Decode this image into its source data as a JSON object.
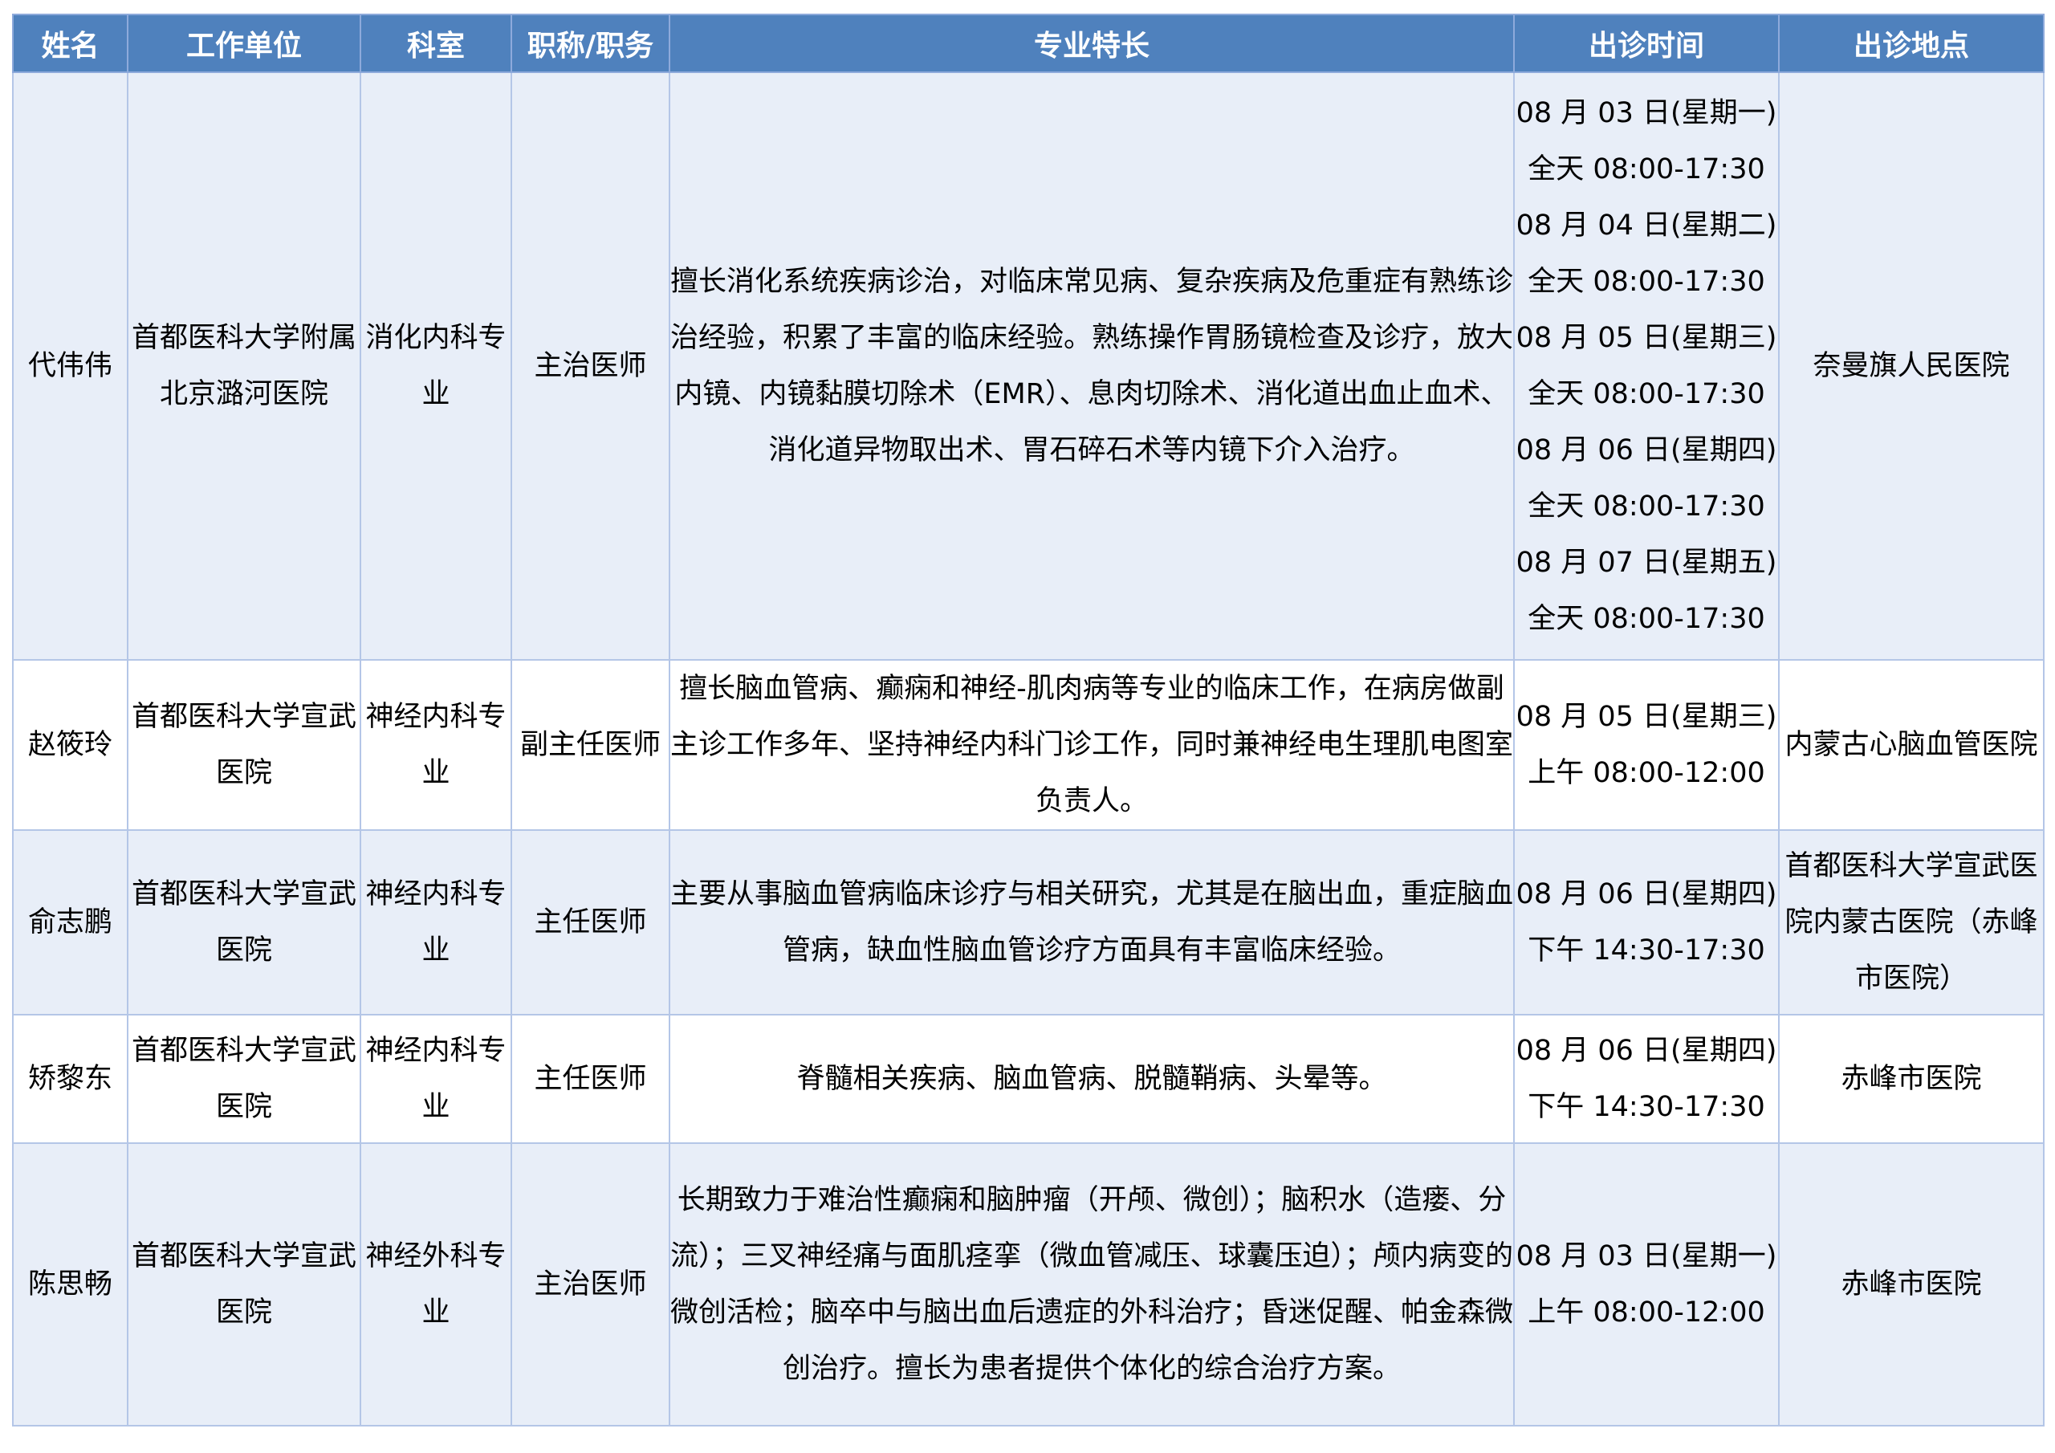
{
  "headers": [
    "姓名",
    "工作单位",
    "科室",
    "职称/职务",
    "专业特长",
    "出诊时间",
    "出诊地点"
  ],
  "rows": [
    {
      "name": "代伟伟",
      "unit": "首都医科大学附属北京潞河医院",
      "dept": "消化内科专业",
      "title": "主治医师",
      "specialty": "擅长消化系统疾病诊治，对临床常见病、复杂疾病及危重症有熟练诊治经验，积累了丰富的临床经验。熟练操作胃肠镜检查及诊疗，放大内镜、内镜黏膜切除术（EMR）、息肉切除术、消化道出血止血术、消化道异物取出术、胃石碎石术等内镜下介入治疗。",
      "times": [
        "08 月 03 日(星期一)",
        "全天 08:00-17:30",
        "08 月 04 日(星期二)",
        "全天 08:00-17:30",
        "08 月 05 日(星期三)",
        "全天 08:00-17:30",
        "08 月 06 日(星期四)",
        "全天 08:00-17:30",
        "08 月 07 日(星期五)",
        "全天 08:00-17:30"
      ],
      "place": "奈曼旗人民医院"
    },
    {
      "name": "赵筱玲",
      "unit": "首都医科大学宣武医院",
      "dept": "神经内科专业",
      "title": "副主任医师",
      "specialty": "擅长脑血管病、癫痫和神经-肌肉病等专业的临床工作，在病房做副主诊工作多年、坚持神经内科门诊工作，同时兼神经电生理肌电图室负责人。",
      "times": [
        "08 月 05 日(星期三)",
        "上午 08:00-12:00"
      ],
      "place": "内蒙古心脑血管医院"
    },
    {
      "name": "俞志鹏",
      "unit": "首都医科大学宣武医院",
      "dept": "神经内科专业",
      "title": "主任医师",
      "specialty": "主要从事脑血管病临床诊疗与相关研究，尤其是在脑出血，重症脑血管病，缺血性脑血管诊疗方面具有丰富临床经验。",
      "times": [
        "08 月 06 日(星期四)",
        "下午 14:30-17:30"
      ],
      "place": "首都医科大学宣武医院内蒙古医院（赤峰市医院）"
    },
    {
      "name": "矫黎东",
      "unit": "首都医科大学宣武医院",
      "dept": "神经内科专业",
      "title": "主任医师",
      "specialty": "脊髓相关疾病、脑血管病、脱髓鞘病、头晕等。",
      "times": [
        "08 月 06 日(星期四)",
        "下午 14:30-17:30"
      ],
      "place": "赤峰市医院"
    },
    {
      "name": "陈思畅",
      "unit": "首都医科大学宣武医院",
      "dept": "神经外科专业",
      "title": "主治医师",
      "specialty": "长期致力于难治性癫痫和脑肿瘤（开颅、微创）；脑积水（造瘘、分流）；三叉神经痛与面肌痉挛（微血管减压、球囊压迫）；颅内病变的微创活检；脑卒中与脑出血后遗症的外科治疗；昏迷促醒、帕金森微创治疗。擅长为患者提供个体化的综合治疗方案。",
      "times": [
        "08 月 03 日(星期一)",
        "上午 08:00-12:00"
      ],
      "place": "赤峰市医院"
    }
  ]
}
